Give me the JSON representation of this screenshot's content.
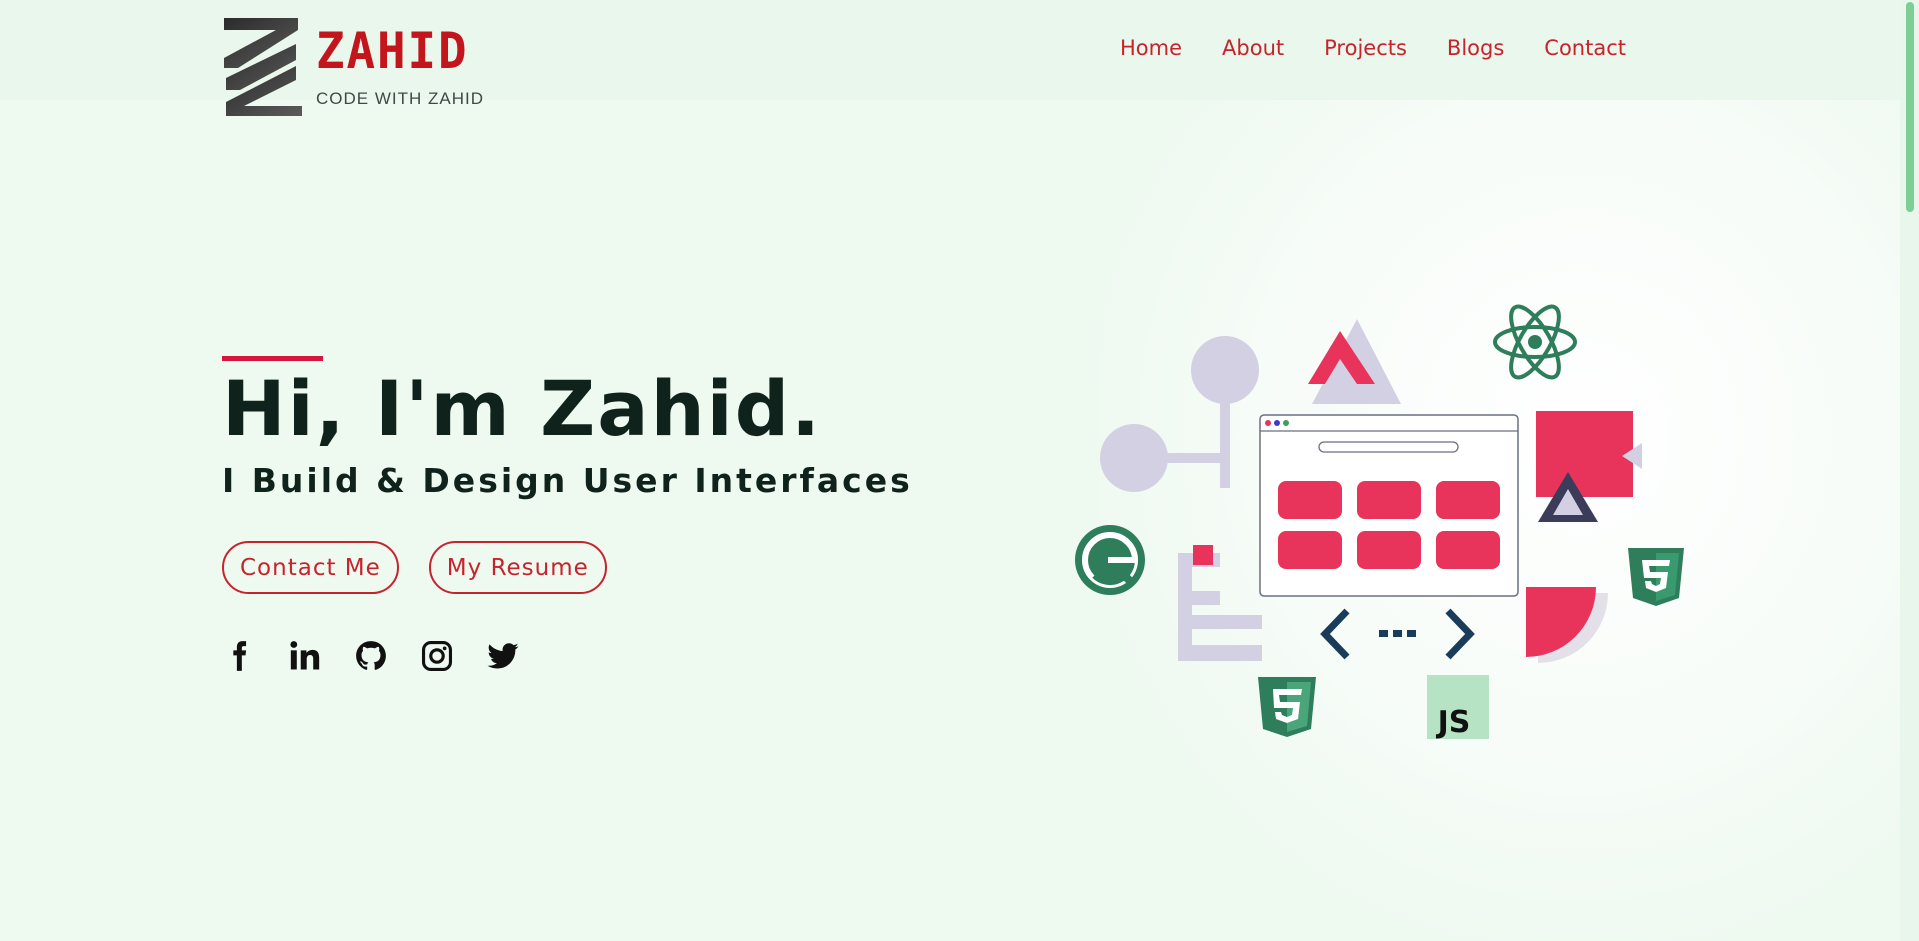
{
  "brand": {
    "name": "ZAHID",
    "tagline": "CODE WITH ZAHID"
  },
  "nav": {
    "items": [
      {
        "label": "Home"
      },
      {
        "label": "About"
      },
      {
        "label": "Projects"
      },
      {
        "label": "Blogs"
      },
      {
        "label": "Contact"
      }
    ]
  },
  "hero": {
    "title": "Hi, I'm Zahid.",
    "subtitle": "I Build & Design User Interfaces",
    "buttons": {
      "contact": "Contact Me",
      "resume": "My Resume"
    }
  },
  "social": [
    {
      "icon": "facebook-icon"
    },
    {
      "icon": "linkedin-icon"
    },
    {
      "icon": "github-icon"
    },
    {
      "icon": "instagram-icon"
    },
    {
      "icon": "twitter-icon"
    }
  ],
  "illustration": {
    "badge_text": "JS"
  },
  "colors": {
    "accent": "#c8232c",
    "highlight": "#d7143f",
    "background": "#eef9f0",
    "header": "#e9f7ec",
    "pink": "#e8345a",
    "lavender": "#d4d0e3",
    "green": "#2e7d5b",
    "navy": "#193c5a",
    "text": "#0f231c"
  }
}
